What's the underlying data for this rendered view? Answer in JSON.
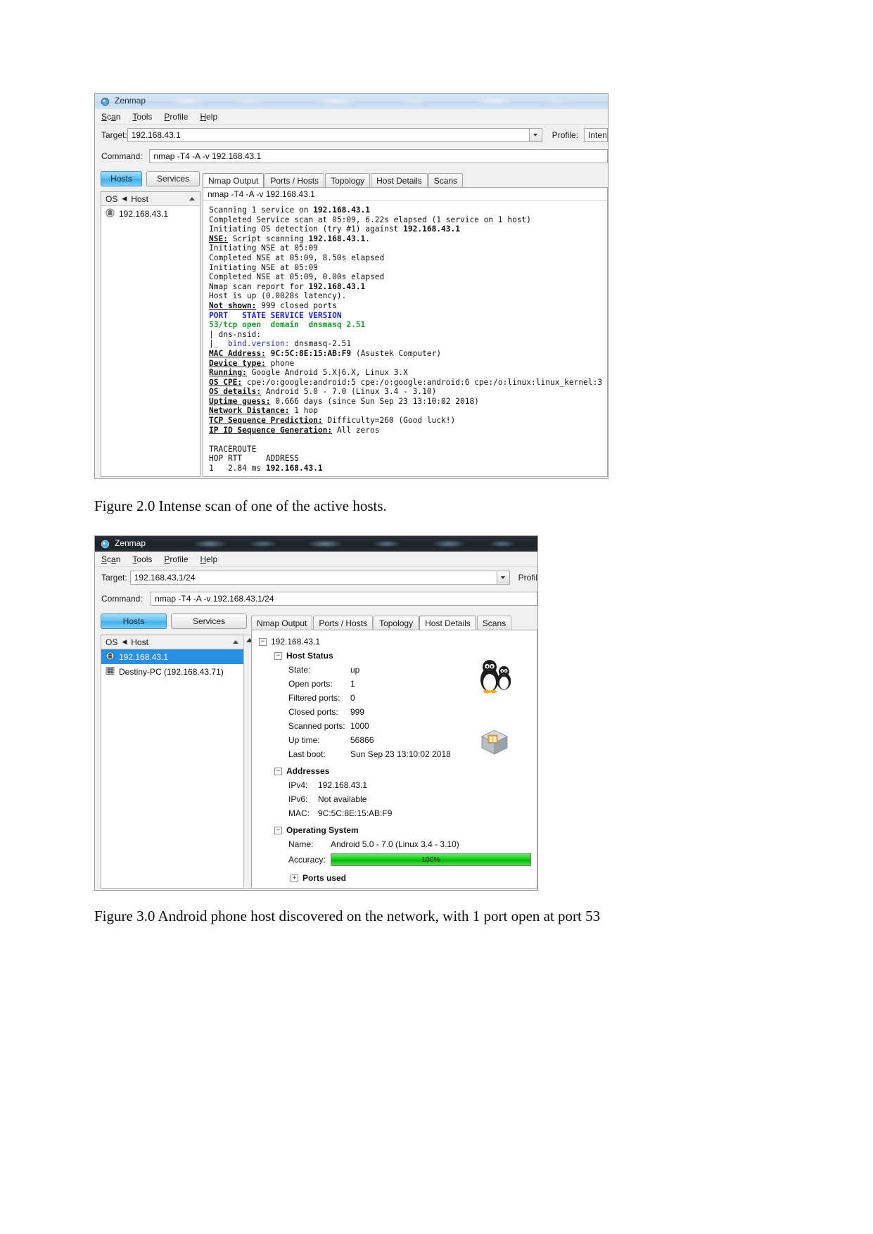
{
  "figure1": {
    "window_title": "Zenmap",
    "menu": [
      "Scan",
      "Tools",
      "Profile",
      "Help"
    ],
    "target_label": "Target:",
    "target_value": "192.168.43.1",
    "profile_label": "Profile:",
    "profile_value": "Intense scan",
    "command_label": "Command:",
    "command_value": "nmap -T4 -A -v 192.168.43.1",
    "left_buttons": [
      "Hosts",
      "Services"
    ],
    "active_left_button": "Hosts",
    "col_os": "OS",
    "col_host": "Host",
    "hosts": [
      "192.168.43.1"
    ],
    "tabs": [
      "Nmap Output",
      "Ports / Hosts",
      "Topology",
      "Host Details",
      "Scans"
    ],
    "active_tab": "Nmap Output",
    "output_command": "nmap -T4 -A -v 192.168.43.1",
    "output_lines": [
      "Scanning 1 service on 192.168.43.1",
      "Completed Service scan at 05:09, 6.22s elapsed (1 service on 1 host)",
      "Initiating OS detection (try #1) against 192.168.43.1",
      "NSE: Script scanning 192.168.43.1.",
      "Initiating NSE at 05:09",
      "Completed NSE at 05:09, 8.50s elapsed",
      "Initiating NSE at 05:09",
      "Completed NSE at 05:09, 0.00s elapsed",
      "Nmap scan report for 192.168.43.1",
      "Host is up (0.0028s latency).",
      "Not shown: 999 closed ports",
      "PORT   STATE SERVICE VERSION",
      "53/tcp open  domain  dnsmasq 2.51",
      "| dns-nsid:",
      "|_  bind.version: dnsmasq-2.51",
      "MAC Address: 9C:5C:8E:15:AB:F9 (Asustek Computer)",
      "Device type: phone",
      "Running: Google Android 5.X|6.X, Linux 3.X",
      "OS CPE: cpe:/o:google:android:5 cpe:/o:google:android:6 cpe:/o:linux:linux_kernel:3",
      "OS details: Android 5.0 - 7.0 (Linux 3.4 - 3.10)",
      "Uptime guess: 0.666 days (since Sun Sep 23 13:10:02 2018)",
      "Network Distance: 1 hop",
      "TCP Sequence Prediction: Difficulty=260 (Good luck!)",
      "IP ID Sequence Generation: All zeros",
      "",
      "TRACEROUTE",
      "HOP RTT     ADDRESS",
      "1   2.84 ms 192.168.43.1"
    ],
    "caption": "Figure 2.0 Intense scan of  one of the active hosts."
  },
  "figure2": {
    "window_title": "Zenmap",
    "menu": [
      "Scan",
      "Tools",
      "Profile",
      "Help"
    ],
    "target_label": "Target:",
    "target_value": "192.168.43.1/24",
    "profile_label": "Profil",
    "command_label": "Command:",
    "command_value": "nmap -T4 -A -v 192.168.43.1/24",
    "left_buttons": [
      "Hosts",
      "Services"
    ],
    "active_left_button": "Hosts",
    "col_os": "OS",
    "col_host": "Host",
    "hosts": [
      "192.168.43.1",
      "Destiny-PC (192.168.43.71)"
    ],
    "selected_host": "192.168.43.1",
    "tabs": [
      "Nmap Output",
      "Ports / Hosts",
      "Topology",
      "Host Details",
      "Scans"
    ],
    "active_tab": "Host Details",
    "details": {
      "root": "192.168.43.1",
      "sections": [
        {
          "title": "Host Status",
          "rows": [
            {
              "key": "State:",
              "value": "up"
            },
            {
              "key": "Open ports:",
              "value": "1"
            },
            {
              "key": "Filtered ports:",
              "value": "0"
            },
            {
              "key": "Closed ports:",
              "value": "999"
            },
            {
              "key": "Scanned ports:",
              "value": "1000"
            },
            {
              "key": "Up time:",
              "value": "56866"
            },
            {
              "key": "Last boot:",
              "value": "Sun Sep 23 13:10:02 2018"
            }
          ]
        },
        {
          "title": "Addresses",
          "rows": [
            {
              "key": "IPv4:",
              "value": "192.168.43.1"
            },
            {
              "key": "IPv6:",
              "value": "Not available"
            },
            {
              "key": "MAC:",
              "value": "9C:5C:8E:15:AB:F9"
            }
          ]
        },
        {
          "title": "Operating System",
          "rows": [
            {
              "key": "Name:",
              "value": "Android 5.0 - 7.0 (Linux 3.4 - 3.10)"
            }
          ]
        }
      ],
      "accuracy_label": "Accuracy:",
      "accuracy_value": "100%",
      "ports_used": "Ports used"
    },
    "caption": "Figure 3.0 Android phone host discovered on the network, with 1 port open at port 53"
  },
  "colors": {
    "selection_blue": "#2a8fe0",
    "accuracy_green": "#13c913",
    "nmap_keyword_blue": "#1f1fc0",
    "nmap_open_green": "#1a9c2e"
  }
}
